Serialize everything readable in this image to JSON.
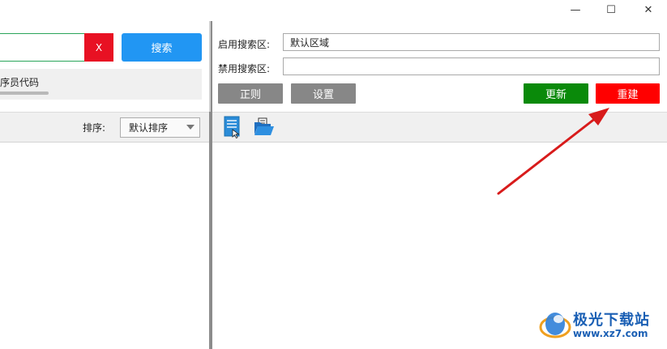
{
  "window": {
    "minimize_glyph": "—",
    "maximize_glyph": "☐",
    "close_glyph": "✕"
  },
  "left": {
    "search_value": "",
    "clear_label": "X",
    "search_label": "搜索",
    "hint_text": "序员代码",
    "progress_fraction": 0.25,
    "sort_label": "排序:",
    "sort_value": "默认排序"
  },
  "right": {
    "enable_label": "启用搜索区:",
    "enable_value": "默认区域",
    "disable_label": "禁用搜索区:",
    "disable_value": "",
    "regex_label": "正则",
    "settings_label": "设置",
    "update_label": "更新",
    "rebuild_label": "重建"
  },
  "toolbar_icons": [
    "document-icon",
    "folder-open-icon"
  ],
  "watermark": {
    "title": "极光下载站",
    "url": "www.xz7.com"
  },
  "colors": {
    "search_blue": "#2196f3",
    "clear_red": "#e81123",
    "update_green": "#0a8a0a",
    "rebuild_red": "#ff0000",
    "gray_button": "#878787",
    "annotation_arrow": "#d81b1b"
  }
}
